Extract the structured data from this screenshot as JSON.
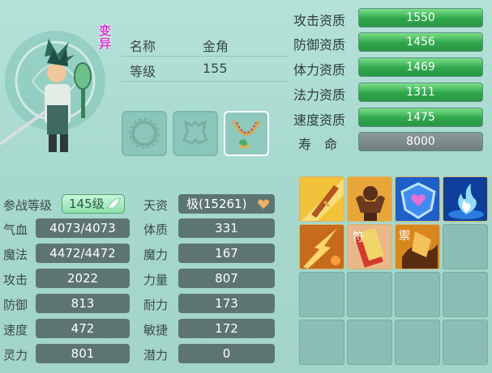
{
  "pet": {
    "mutant_label": "变异",
    "name_label": "名称",
    "name_value": "金角",
    "level_label": "等级",
    "level_value": "155"
  },
  "qualities": [
    {
      "label": "攻击资质",
      "value": "1550",
      "fill": 1.0
    },
    {
      "label": "防御资质",
      "value": "1456",
      "fill": 1.0
    },
    {
      "label": "体力资质",
      "value": "1469",
      "fill": 1.0
    },
    {
      "label": "法力资质",
      "value": "1311",
      "fill": 1.0
    },
    {
      "label": "速度资质",
      "value": "1475",
      "fill": 1.0
    },
    {
      "label": "寿　命",
      "value": "8000",
      "fill": 0.0
    }
  ],
  "stats": {
    "battle_level_label": "参战等级",
    "battle_level_value": "145级",
    "aptitude_label": "天资",
    "aptitude_value": "极(15261)",
    "left": [
      {
        "label": "气血",
        "value": "4073/4073"
      },
      {
        "label": "魔法",
        "value": "4472/4472"
      },
      {
        "label": "攻击",
        "value": "2022"
      },
      {
        "label": "防御",
        "value": "813"
      },
      {
        "label": "速度",
        "value": "472"
      },
      {
        "label": "灵力",
        "value": "801"
      }
    ],
    "right": [
      {
        "label": "体质",
        "value": "331"
      },
      {
        "label": "魔力",
        "value": "167"
      },
      {
        "label": "力量",
        "value": "807"
      },
      {
        "label": "耐力",
        "value": "173"
      },
      {
        "label": "敏捷",
        "value": "172"
      },
      {
        "label": "潜力",
        "value": "0"
      }
    ]
  },
  "skills": [
    {
      "icon": "sword-skill-icon",
      "label": ""
    },
    {
      "icon": "flexing-beast-skill-icon",
      "label": ""
    },
    {
      "icon": "heart-shield-skill-icon",
      "label": ""
    },
    {
      "icon": "blue-flame-skill-icon",
      "label": ""
    },
    {
      "icon": "lightning-skill-icon",
      "label": ""
    },
    {
      "icon": "talisman-skill-icon",
      "label": "符"
    },
    {
      "icon": "dark-talisman-skill-icon",
      "label": "禦"
    }
  ],
  "equipment": [
    "ring-slot-icon",
    "armor-slot-icon",
    "necklace-icon"
  ]
}
